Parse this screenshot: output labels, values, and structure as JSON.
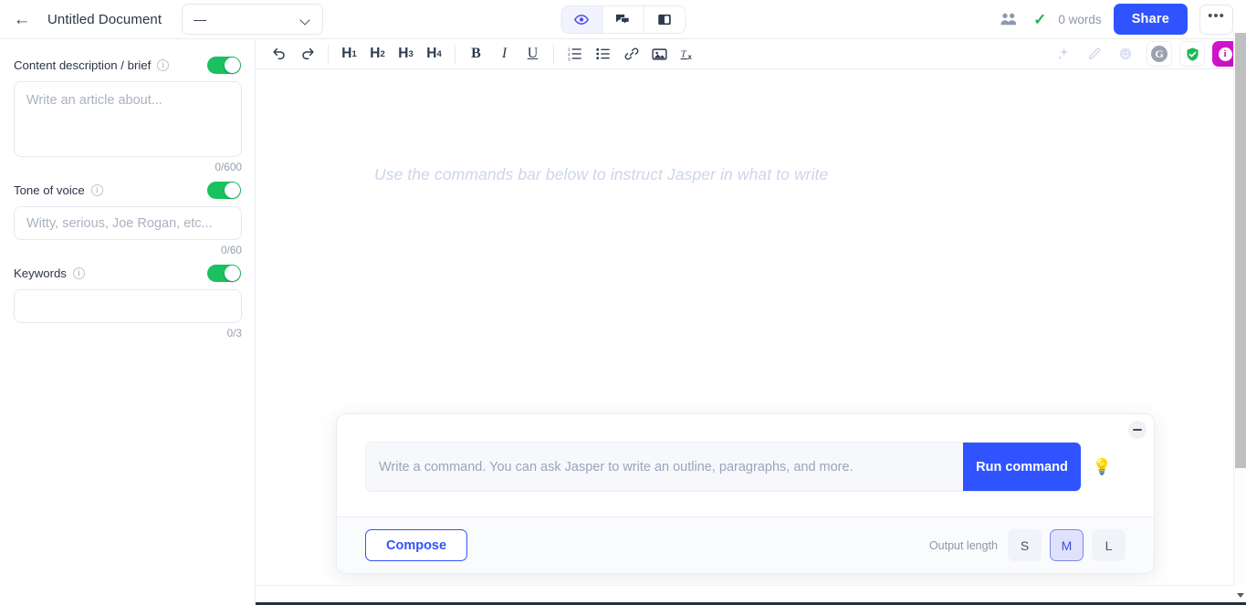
{
  "header": {
    "back_icon": "back-arrow-icon",
    "doc_title": "Untitled Document",
    "template_value": "—",
    "view_modes": [
      {
        "name": "eye-icon",
        "label": "Preview",
        "active": true
      },
      {
        "name": "comments-icon",
        "label": "Comments",
        "active": false
      },
      {
        "name": "sidebar-panel-icon",
        "label": "Panel",
        "active": false
      }
    ],
    "collaborators_icon": "people-icon",
    "saved_icon": "check-icon",
    "word_count": "0 words",
    "share_label": "Share",
    "more_label": "•••"
  },
  "sidebar": {
    "fields": [
      {
        "label": "Content description / brief",
        "info_icon": "info-icon",
        "toggle_on": true,
        "placeholder": "Write an article about...",
        "value": "",
        "counter": "0/600",
        "type": "textarea"
      },
      {
        "label": "Tone of voice",
        "info_icon": "info-icon",
        "toggle_on": true,
        "placeholder": "Witty, serious, Joe Rogan, etc...",
        "value": "",
        "counter": "0/60",
        "type": "input"
      },
      {
        "label": "Keywords",
        "info_icon": "info-icon",
        "toggle_on": true,
        "placeholder": "",
        "value": "",
        "counter": "0/3",
        "type": "input"
      }
    ]
  },
  "toolbar": {
    "items": [
      {
        "name": "undo-icon",
        "label": "Undo"
      },
      {
        "name": "redo-icon",
        "label": "Redo"
      },
      {
        "name": "heading-1-button",
        "label": "H1"
      },
      {
        "name": "heading-2-button",
        "label": "H2"
      },
      {
        "name": "heading-3-button",
        "label": "H3"
      },
      {
        "name": "heading-4-button",
        "label": "H4"
      },
      {
        "name": "bold-button",
        "label": "B"
      },
      {
        "name": "italic-button",
        "label": "I"
      },
      {
        "name": "underline-button",
        "label": "U"
      },
      {
        "name": "ordered-list-icon",
        "label": "Numbered list"
      },
      {
        "name": "bullet-list-icon",
        "label": "Bullet list"
      },
      {
        "name": "link-icon",
        "label": "Link"
      },
      {
        "name": "image-icon",
        "label": "Image"
      },
      {
        "name": "clear-formatting-icon",
        "label": "Tx"
      }
    ],
    "right_items": [
      {
        "name": "sparkle-icon",
        "label": "AI assist"
      },
      {
        "name": "pencil-icon",
        "label": "Edit"
      },
      {
        "name": "emoji-icon",
        "label": "Emoji"
      },
      {
        "name": "grammarly-icon",
        "label": "G"
      },
      {
        "name": "shield-check-icon",
        "label": "Plagiarism check"
      },
      {
        "name": "info-badge-icon",
        "label": "i"
      }
    ]
  },
  "canvas": {
    "placeholder": "Use the commands bar below to instruct Jasper in what to write"
  },
  "command_panel": {
    "minimize_label": "Minimize",
    "input_placeholder": "Write a command. You can ask Jasper to write an outline, paragraphs, and more.",
    "input_value": "",
    "run_label": "Run command",
    "bulb_icon": "lightbulb-icon",
    "compose_label": "Compose",
    "output_length_label": "Output length",
    "length_options": [
      {
        "label": "S",
        "selected": false
      },
      {
        "label": "M",
        "selected": true
      },
      {
        "label": "L",
        "selected": false
      }
    ]
  },
  "colors": {
    "brand_blue": "#2f54ff",
    "accent_purple": "#4f4fe8",
    "toggle_green": "#19c15f",
    "check_green": "#22b355",
    "info_magenta": "#c90fc2",
    "selected_chip_bg": "#dfe2fd",
    "selected_chip_border": "#7b86e8"
  }
}
